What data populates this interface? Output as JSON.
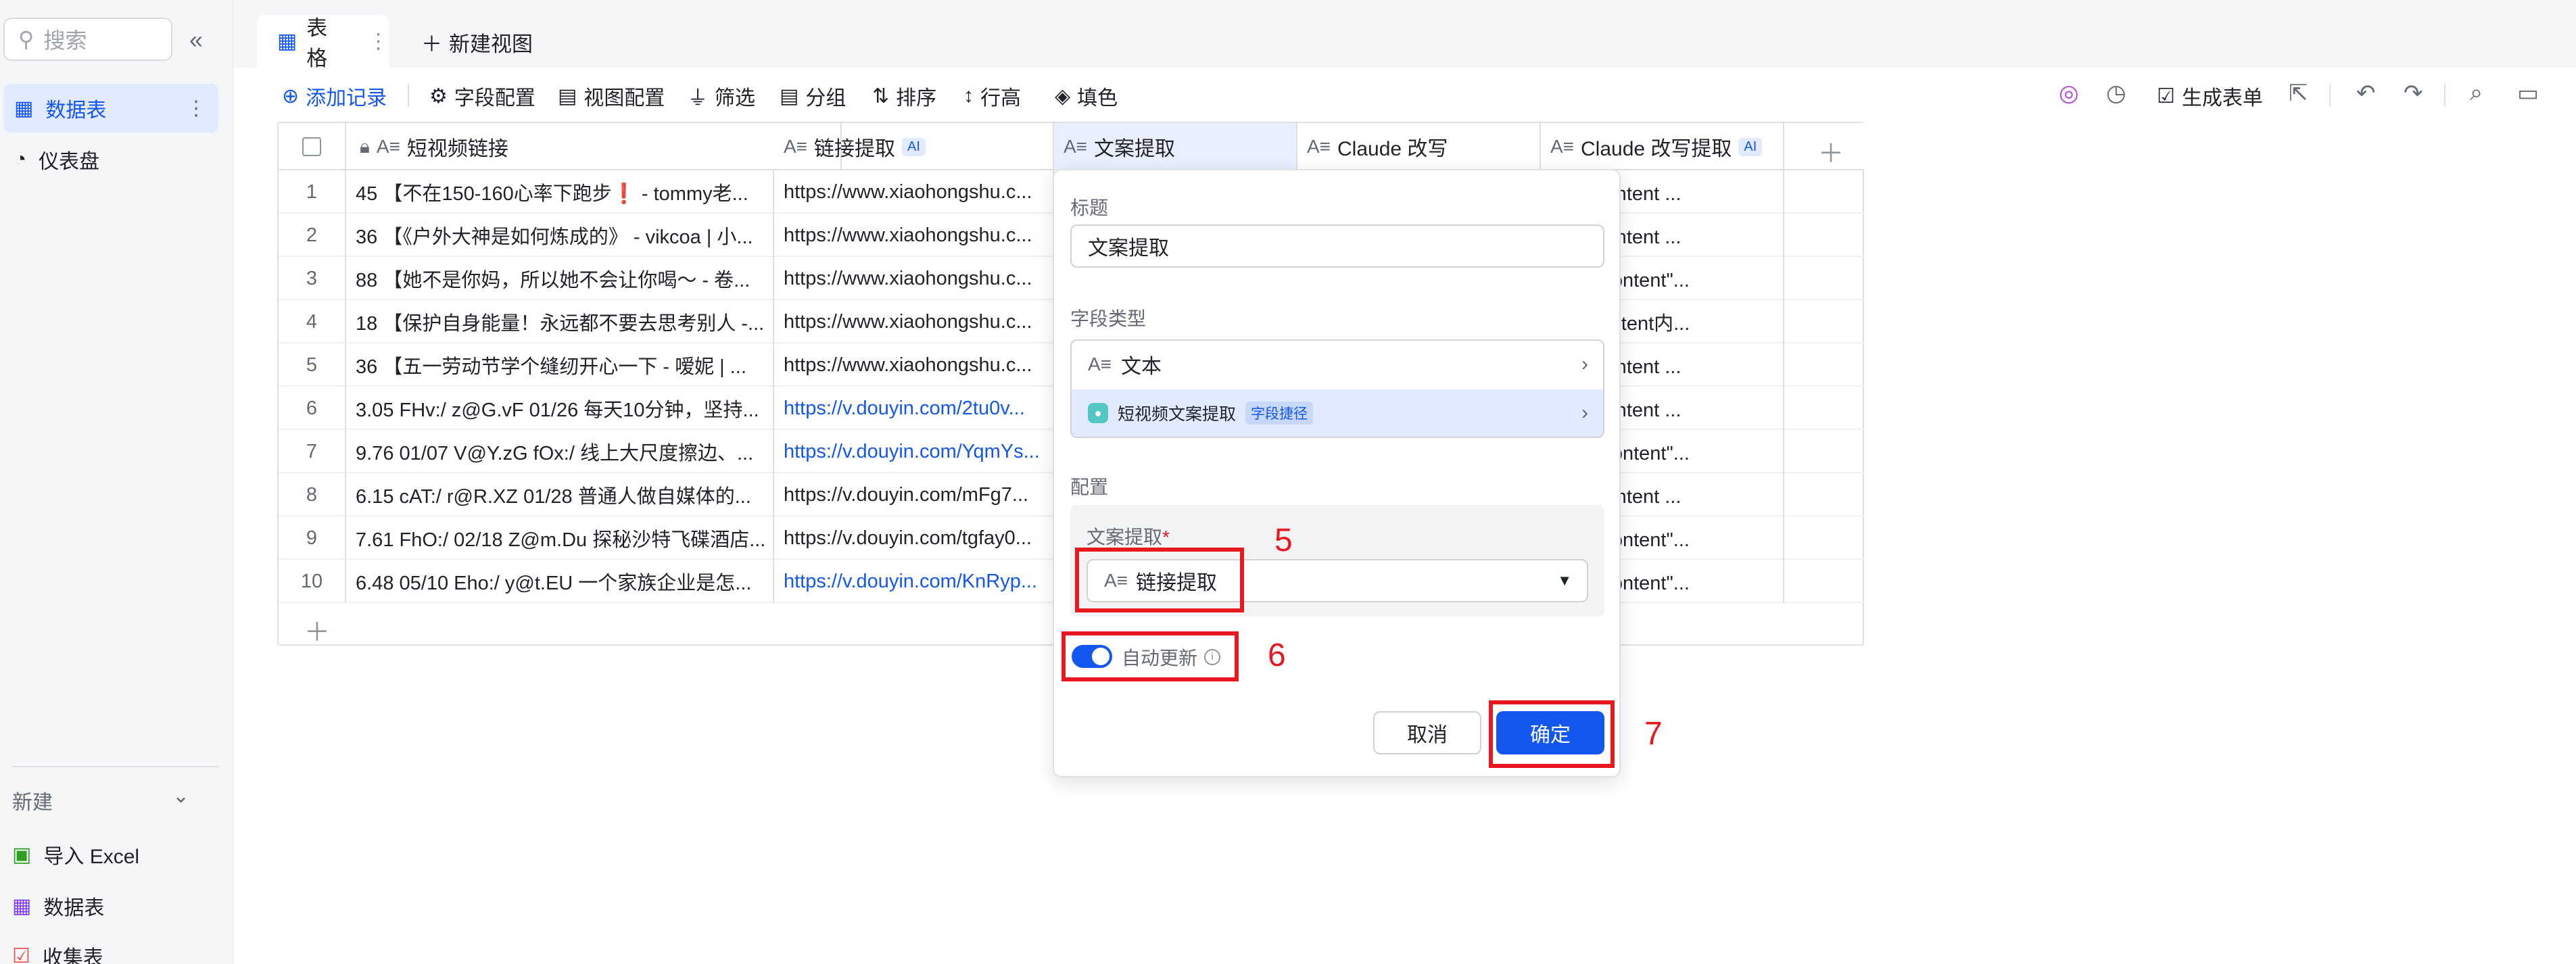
{
  "sidebar": {
    "search_placeholder": "搜索",
    "collapse_icon": "«",
    "items": [
      {
        "label": "数据表",
        "icon": "table-icon",
        "active": true
      },
      {
        "label": "仪表盘",
        "icon": "dashboard-icon",
        "active": false
      }
    ],
    "new_label": "新建",
    "links": [
      {
        "label": "导入 Excel",
        "icon": "excel-icon",
        "color": "#2ea121"
      },
      {
        "label": "数据表",
        "icon": "table-icon",
        "color": "#7f3bf5"
      },
      {
        "label": "收集表",
        "icon": "form-icon",
        "color": "#f54a45"
      }
    ]
  },
  "tabs": {
    "current": "表格",
    "new_view": "新建视图"
  },
  "toolbar": {
    "add_record": "添加记录",
    "field_config": "字段配置",
    "view_config": "视图配置",
    "filter": "筛选",
    "group": "分组",
    "sort": "排序",
    "row_height": "行高",
    "fill": "填色",
    "generate_form": "生成表单"
  },
  "table": {
    "columns": [
      {
        "label": "短视频链接",
        "ai": false
      },
      {
        "label": "链接提取",
        "ai": true
      },
      {
        "label": "文案提取",
        "ai": false
      },
      {
        "label": "Claude 改写",
        "ai": false
      },
      {
        "label": "Claude 改写提取",
        "ai": true
      }
    ],
    "ai_tag": "AI",
    "rows": [
      {
        "idx": "1",
        "video": "45 【不在150-160心率下跑步❗️ - tommy老...",
        "link": "https://www.xiaohongshu.c...",
        "link_blue": false,
        "claude": "求的 content ..."
      },
      {
        "idx": "2",
        "video": "36 【《户外大神是如何炼成的》 - vikcoa | 小...",
        "link": "https://www.xiaohongshu.c...",
        "link_blue": false,
        "claude": "求的 content ..."
      },
      {
        "idx": "3",
        "video": "88 【她不是你妈，所以她不会让你喝～ - 卷...",
        "link": "https://www.xiaohongshu.c...",
        "link_blue": false,
        "claude": "求的 \"content\"..."
      },
      {
        "idx": "4",
        "video": "18 【保护自身能量！永远都不要去思考别人 -...",
        "link": "https://www.xiaohongshu.c...",
        "link_blue": false,
        "claude": "求的content内..."
      },
      {
        "idx": "5",
        "video": "36 【五一劳动节学个缝纫开心一下 - 嗳妮 | ...",
        "link": "https://www.xiaohongshu.c...",
        "link_blue": false,
        "claude": "求的 content ..."
      },
      {
        "idx": "6",
        "video": "3.05 FHv:/ z@G.vF 01/26 每天10分钟，坚持...",
        "link": "https://v.douyin.com/2tu0v...",
        "link_blue": true,
        "claude": "求的 content ..."
      },
      {
        "idx": "7",
        "video": "9.76 01/07 V@Y.zG fOx:/ 线上大尺度擦边、...",
        "link": "https://v.douyin.com/YqmYs...",
        "link_blue": true,
        "claude": "求的 \"content\"..."
      },
      {
        "idx": "8",
        "video": "6.15 cAT:/ r@R.XZ 01/28 普通人做自媒体的...",
        "link": "https://v.douyin.com/mFg7...",
        "link_blue": false,
        "claude": "求的 content ..."
      },
      {
        "idx": "9",
        "video": "7.61 FhO:/ 02/18 Z@m.Du 探秘沙特飞碟酒店...",
        "link": "https://v.douyin.com/tgfay0...",
        "link_blue": false,
        "claude": "求的 \"content\"..."
      },
      {
        "idx": "10",
        "video": "6.48 05/10 Eho:/ y@t.EU 一个家族企业是怎...",
        "link": "https://v.douyin.com/KnRyp...",
        "link_blue": true,
        "claude": "求的 \"content\"..."
      }
    ]
  },
  "popup": {
    "title_label": "标题",
    "title_value": "文案提取",
    "field_type_label": "字段类型",
    "type_text": "文本",
    "type_extract": "短视频文案提取",
    "shortcut_tag": "字段捷径",
    "config_label": "配置",
    "source_label": "文案提取",
    "required_mark": "*",
    "source_value": "链接提取",
    "auto_update": "自动更新",
    "cancel": "取消",
    "confirm": "确定"
  },
  "annotations": {
    "n5": "5",
    "n6": "6",
    "n7": "7",
    "color": "#e8181f"
  }
}
